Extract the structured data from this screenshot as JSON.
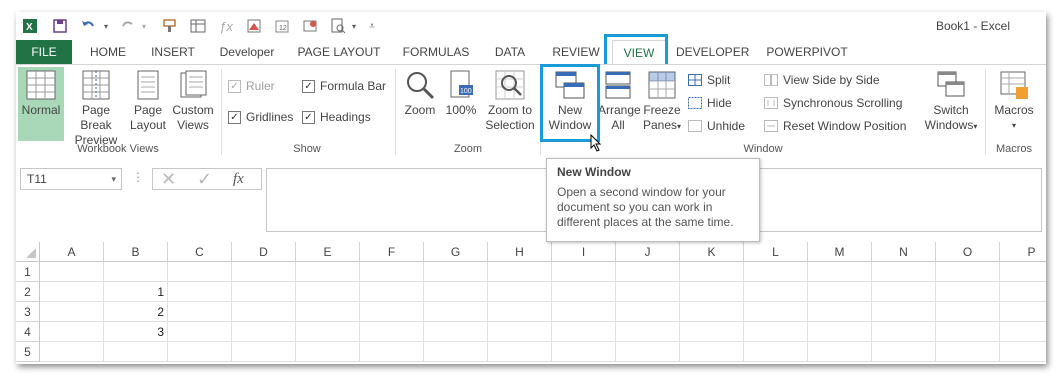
{
  "window": {
    "title": "Book1 - Excel"
  },
  "qat": {
    "icons": [
      "excel-logo-icon",
      "save-icon",
      "undo-icon",
      "redo-icon",
      "format-painter-icon",
      "table-icon",
      "formula-icon",
      "new-window-icon",
      "calendar-icon",
      "record-icon",
      "print-preview-icon",
      "qat-dropdown-icon"
    ]
  },
  "tabs": [
    "FILE",
    "HOME",
    "INSERT",
    "Developer",
    "PAGE LAYOUT",
    "FORMULAS",
    "DATA",
    "REVIEW",
    "VIEW",
    "DEVELOPER",
    "POWERPIVOT"
  ],
  "ribbon": {
    "workbook_views": {
      "label": "Workbook Views",
      "normal": "Normal",
      "page_break_1": "Page Break",
      "page_break_2": "Preview",
      "page_layout_1": "Page",
      "page_layout_2": "Layout",
      "custom_1": "Custom",
      "custom_2": "Views"
    },
    "show": {
      "label": "Show",
      "ruler": "Ruler",
      "formula_bar": "Formula Bar",
      "gridlines": "Gridlines",
      "headings": "Headings"
    },
    "zoom": {
      "label": "Zoom",
      "zoom": "Zoom",
      "hundred": "100%",
      "zoom_sel_1": "Zoom to",
      "zoom_sel_2": "Selection"
    },
    "window": {
      "label": "Window",
      "new_window_1": "New",
      "new_window_2": "Window",
      "arrange_1": "Arrange",
      "arrange_2": "All",
      "freeze_1": "Freeze",
      "freeze_2": "Panes",
      "split": "Split",
      "hide": "Hide",
      "unhide": "Unhide",
      "side_by_side": "View Side by Side",
      "sync_scroll": "Synchronous Scrolling",
      "reset_pos": "Reset Window Position",
      "switch_1": "Switch",
      "switch_2": "Windows"
    },
    "macros": {
      "label": "Macros",
      "macros": "Macros"
    }
  },
  "formula_bar": {
    "name_box": "T11",
    "fx": "fx",
    "value": ""
  },
  "tooltip": {
    "title": "New Window",
    "body_1": "Open a second window for your",
    "body_2": "document so you can work in",
    "body_3": "different places at the same time."
  },
  "grid": {
    "columns": [
      "A",
      "B",
      "C",
      "D",
      "E",
      "F",
      "G",
      "H",
      "I",
      "J",
      "K",
      "L",
      "M",
      "N",
      "O",
      "P"
    ],
    "rows": [
      "1",
      "2",
      "3",
      "4",
      "5"
    ],
    "b_values": [
      "",
      "1",
      "2",
      "3",
      ""
    ]
  },
  "colors": {
    "accent": "#217346",
    "highlight": "#1a9ad6",
    "selected_view": "#a9d8b8"
  }
}
